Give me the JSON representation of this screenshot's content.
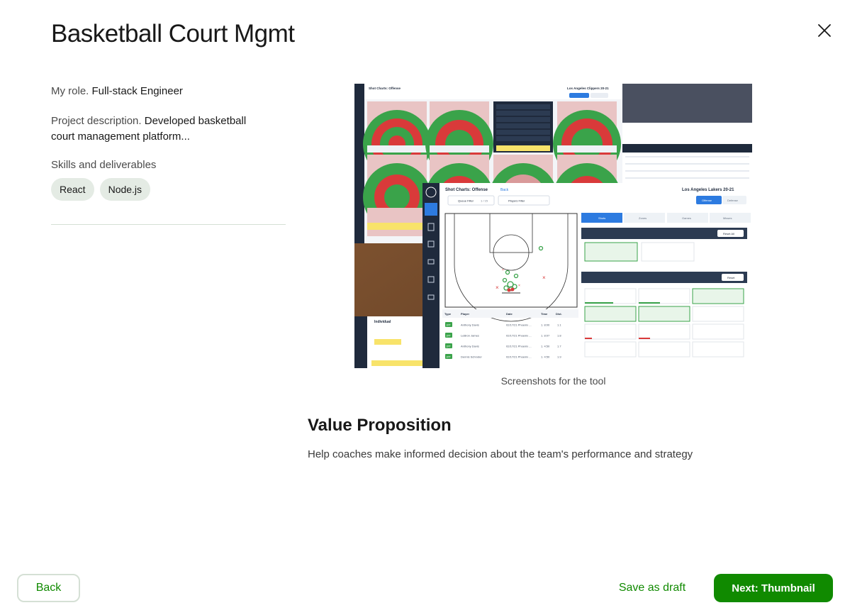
{
  "modal": {
    "title": "Basketball Court Mgmt"
  },
  "details": {
    "role_label": "My role.",
    "role_value": "Full-stack Engineer",
    "description_label": "Project description.",
    "description_value": "Developed basketball court management platform...",
    "skills_label": "Skills and deliverables",
    "skills": [
      "React",
      "Node.js"
    ]
  },
  "media": {
    "caption": "Screenshots for the tool",
    "screenshot": {
      "back_title": "Shot Charts: Offense",
      "back_team": "Los Angeles Clippers 20-21",
      "front_title": "Shot Charts: Offense",
      "front_back_link": "Back",
      "front_team": "Los Angeles Lakers 20-21",
      "queue_filter": "Queue Filter",
      "queue_count": "1 / 15",
      "players_filter": "Players Filter",
      "tab_offense": "Offense",
      "tab_defense": "Defense",
      "view_tabs": [
        "Shots",
        "Zones",
        "Games",
        "Misses"
      ],
      "table_headers": [
        "Type",
        "Player",
        "Date",
        "Time",
        "Dist."
      ],
      "table_rows": [
        {
          "type": "2PT",
          "player": "Anthony Davis",
          "date": "02/17/21 Phoenix ...",
          "time": "1. 8:00",
          "dist": "1.1"
        },
        {
          "type": "2PT",
          "player": "LeBron James",
          "date": "02/17/21 Phoenix ...",
          "time": "1. 8:07",
          "dist": "1.8"
        },
        {
          "type": "2PT",
          "player": "Anthony Davis",
          "date": "02/17/21 Phoenix ...",
          "time": "1. 4:50",
          "dist": "1.7"
        },
        {
          "type": "2PT",
          "player": "Dennis Schroder",
          "date": "02/17/21 Phoenix ...",
          "time": "1. 4:50",
          "dist": "1.9"
        }
      ],
      "individual_label": "Individual",
      "reset_all": "Reset All",
      "reset": "Reset"
    }
  },
  "value_proposition": {
    "title": "Value Proposition",
    "text": "Help coaches make informed decision about the team's performance and strategy"
  },
  "footer": {
    "back_label": "Back",
    "draft_label": "Save as draft",
    "next_label": "Next: Thumbnail"
  },
  "colors": {
    "brand_green": "#108a00",
    "chip_bg": "#e4ebe4",
    "border": "#d5e0d5"
  }
}
